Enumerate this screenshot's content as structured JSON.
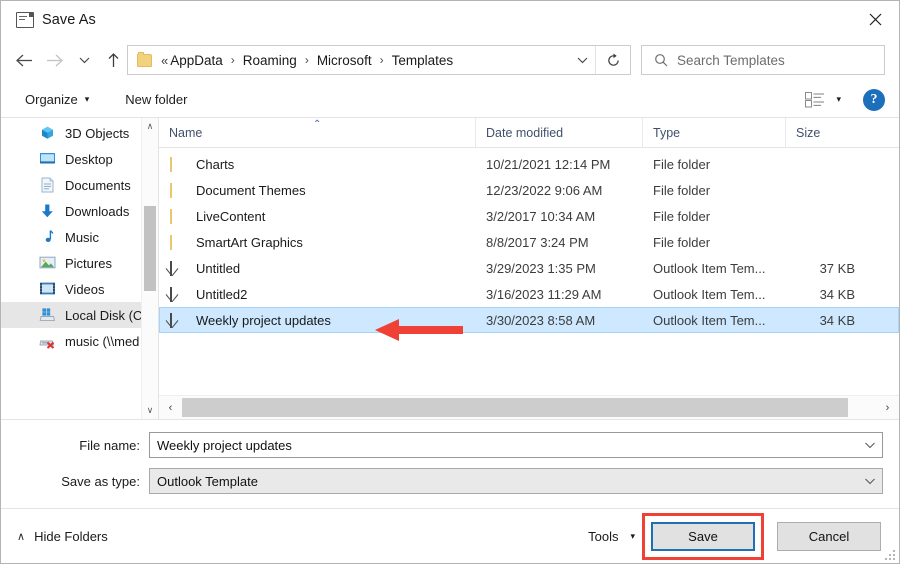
{
  "window": {
    "title": "Save As",
    "icon": "dialog-icon",
    "close_label": "✕"
  },
  "nav": {
    "back": "←",
    "forward": "→",
    "recent": "∨",
    "up": "↑",
    "breadcrumb": {
      "overflow": "«",
      "separator": "›",
      "items": [
        "AppData",
        "Roaming",
        "Microsoft",
        "Templates"
      ]
    },
    "address_dropdown": "∨",
    "refresh": "↻",
    "search": {
      "placeholder": "Search Templates",
      "value": "",
      "icon": "search-icon"
    }
  },
  "toolbar": {
    "organize_label": "Organize",
    "organize_caret": "▾",
    "new_folder_label": "New folder",
    "view_caret": "▾",
    "help_label": "?"
  },
  "sidebar": {
    "scroll_up": "∧",
    "scroll_down": "∨",
    "items": [
      {
        "label": "3D Objects",
        "icon": "3d-objects-icon",
        "selected": false
      },
      {
        "label": "Desktop",
        "icon": "desktop-icon",
        "selected": false
      },
      {
        "label": "Documents",
        "icon": "documents-icon",
        "selected": false
      },
      {
        "label": "Downloads",
        "icon": "downloads-icon",
        "selected": false
      },
      {
        "label": "Music",
        "icon": "music-icon",
        "selected": false
      },
      {
        "label": "Pictures",
        "icon": "pictures-icon",
        "selected": false
      },
      {
        "label": "Videos",
        "icon": "videos-icon",
        "selected": false
      },
      {
        "label": "Local Disk (C:",
        "icon": "local-disk-icon",
        "selected": true
      },
      {
        "label": "music (\\\\med",
        "icon": "network-drive-icon",
        "selected": false
      }
    ]
  },
  "filelist": {
    "columns": [
      {
        "label": "Name",
        "sorted": "asc",
        "sort_caret": "⌃"
      },
      {
        "label": "Date modified",
        "sorted": ""
      },
      {
        "label": "Type",
        "sorted": ""
      },
      {
        "label": "Size",
        "sorted": ""
      }
    ],
    "rows": [
      {
        "name": "Charts",
        "date": "10/21/2021 12:14 PM",
        "type": "File folder",
        "size": "",
        "icon": "folder-icon",
        "selected": false
      },
      {
        "name": "Document Themes",
        "date": "12/23/2022 9:06 AM",
        "type": "File folder",
        "size": "",
        "icon": "folder-icon",
        "selected": false
      },
      {
        "name": "LiveContent",
        "date": "3/2/2017 10:34 AM",
        "type": "File folder",
        "size": "",
        "icon": "folder-icon",
        "selected": false
      },
      {
        "name": "SmartArt Graphics",
        "date": "8/8/2017 3:24 PM",
        "type": "File folder",
        "size": "",
        "icon": "folder-icon",
        "selected": false
      },
      {
        "name": "Untitled",
        "date": "3/29/2023 1:35 PM",
        "type": "Outlook Item Tem...",
        "size": "37 KB",
        "icon": "mail-icon",
        "selected": false
      },
      {
        "name": "Untitled2",
        "date": "3/16/2023 11:29 AM",
        "type": "Outlook Item Tem...",
        "size": "34 KB",
        "icon": "mail-icon",
        "selected": false
      },
      {
        "name": "Weekly project updates",
        "date": "3/30/2023 8:58 AM",
        "type": "Outlook Item Tem...",
        "size": "34 KB",
        "icon": "mail-icon",
        "selected": true
      }
    ],
    "hscroll": {
      "left": "‹",
      "right": "›"
    }
  },
  "form": {
    "file_name_label": "File name:",
    "file_name_value": "Weekly project updates",
    "save_as_type_label": "Save as type:",
    "save_as_type_value": "Outlook Template",
    "dropdown_caret": "∨"
  },
  "footer": {
    "hide_folders_label": "Hide Folders",
    "hide_folders_caret": "∧",
    "tools_label": "Tools",
    "tools_caret": "▾",
    "save_label": "Save",
    "cancel_label": "Cancel"
  },
  "annotations": {
    "arrow_color": "#ef4136",
    "highlight_color": "#ef4136",
    "arrow_target": "Weekly project updates",
    "box_target": "Save"
  }
}
